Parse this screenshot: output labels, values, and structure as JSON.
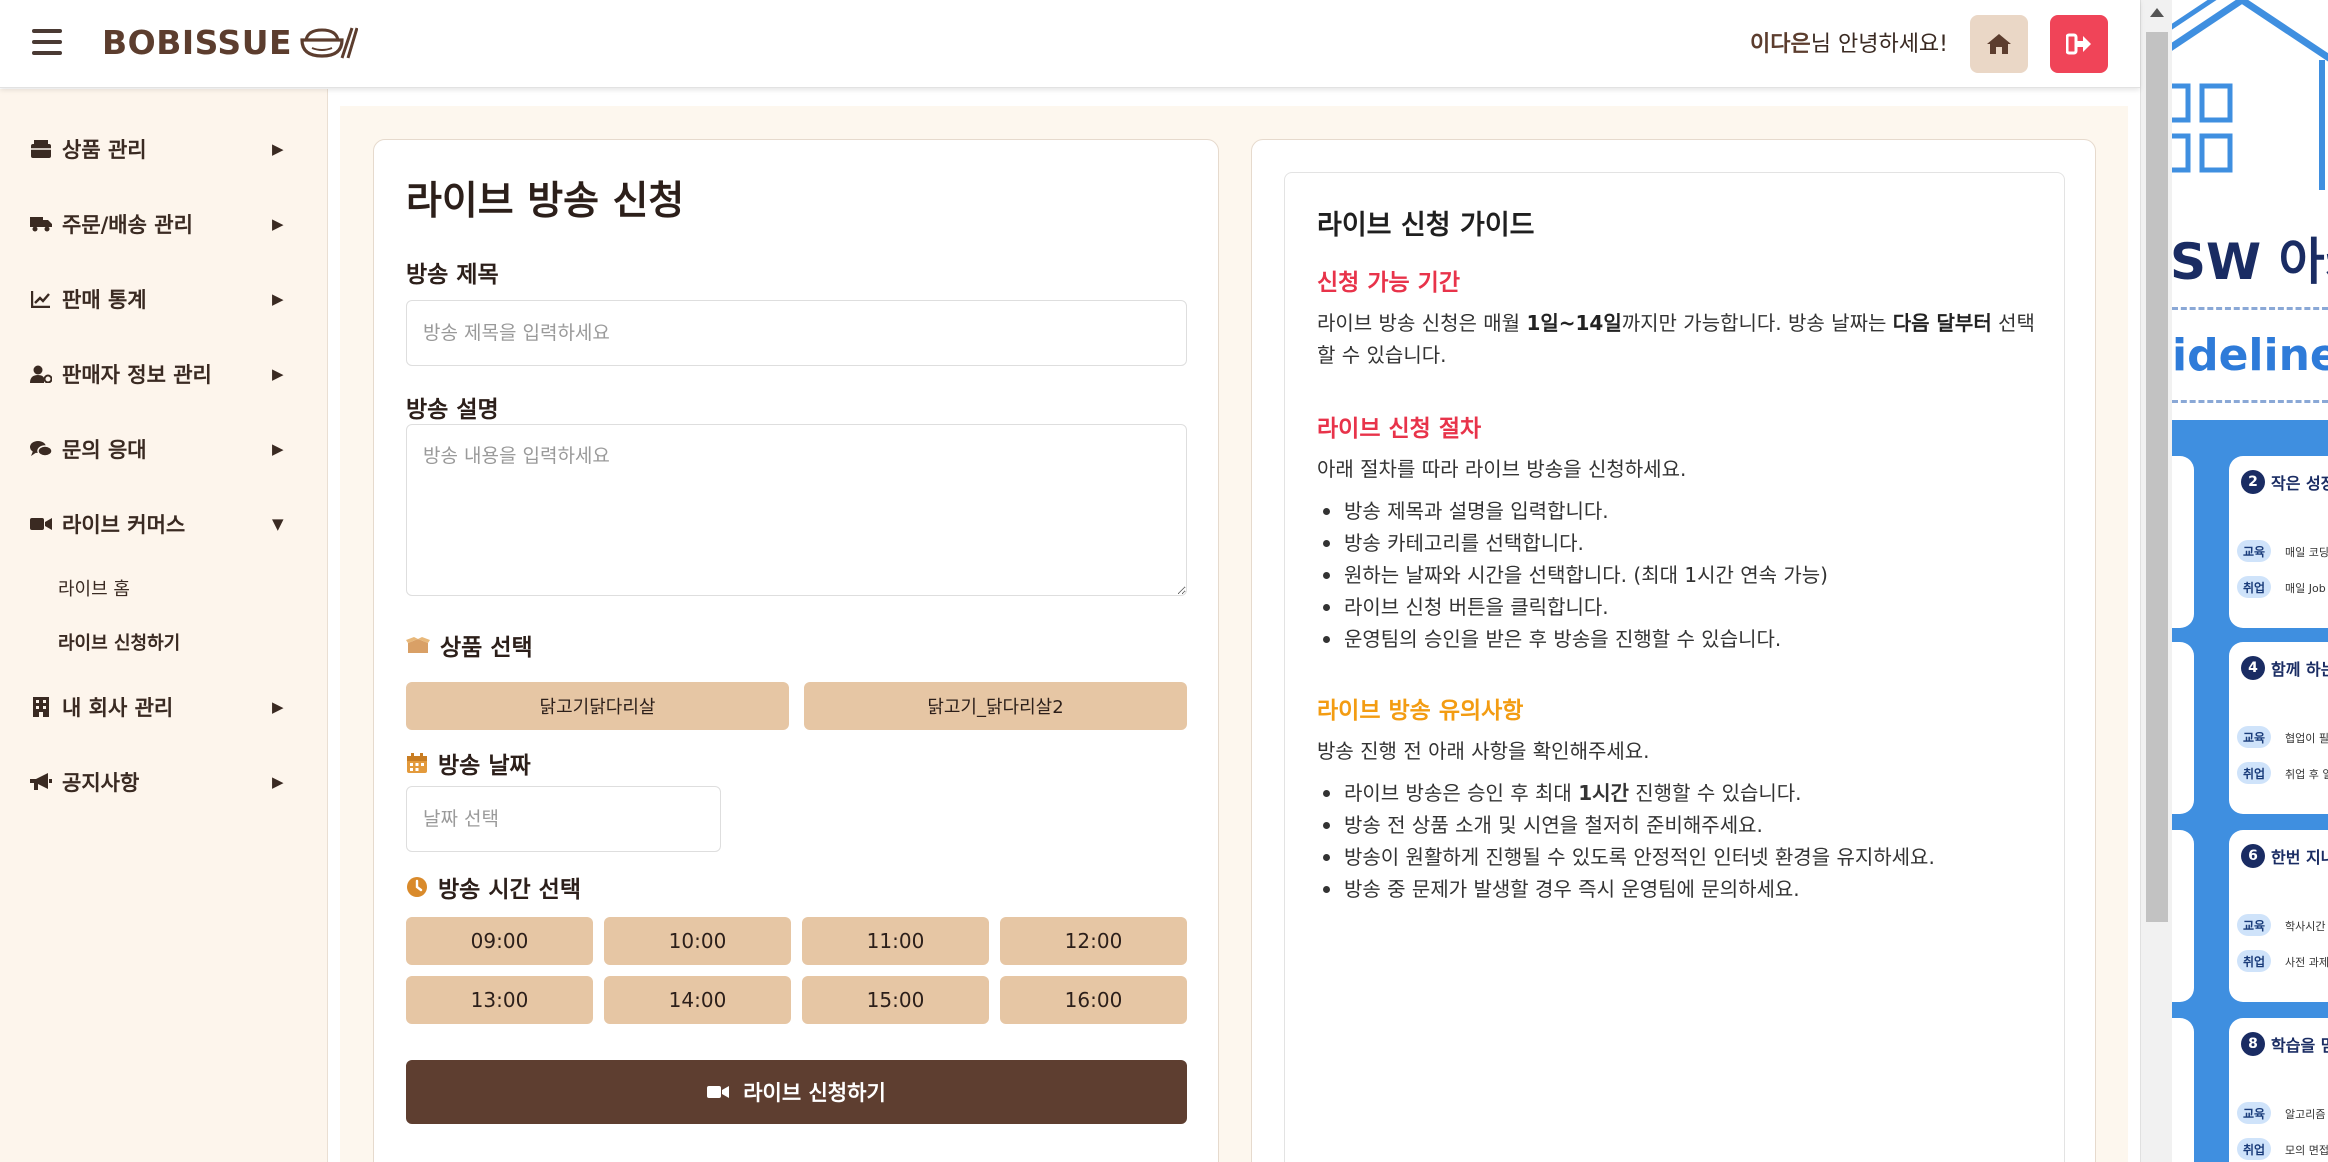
{
  "header": {
    "logo_text": "BOBISSUE",
    "user_name": "이다은",
    "greeting_suffix": "님 안녕하세요!"
  },
  "sidebar": {
    "items": [
      {
        "label": "상품 관리",
        "arrow": "▶",
        "icon": "box-icon"
      },
      {
        "label": "주문/배송 관리",
        "arrow": "▶",
        "icon": "truck-icon"
      },
      {
        "label": "판매 통계",
        "arrow": "▶",
        "icon": "chart-line-icon"
      },
      {
        "label": "판매자 정보 관리",
        "arrow": "▶",
        "icon": "user-gear-icon"
      },
      {
        "label": "문의 응대",
        "arrow": "▶",
        "icon": "comments-icon"
      },
      {
        "label": "라이브 커머스",
        "arrow": "▼",
        "icon": "video-icon"
      },
      {
        "label": "내 회사 관리",
        "arrow": "▶",
        "icon": "building-icon"
      },
      {
        "label": "공지사항",
        "arrow": "▶",
        "icon": "bullhorn-icon"
      }
    ],
    "live_sub": [
      {
        "label": "라이브 홈"
      },
      {
        "label": "라이브 신청하기"
      }
    ]
  },
  "form": {
    "title": "라이브 방송 신청",
    "title_label": "방송 제목",
    "title_placeholder": "방송 제목을 입력하세요",
    "desc_label": "방송 설명",
    "desc_placeholder": "방송 내용을 입력하세요",
    "product_label": "상품 선택",
    "products": [
      "닭고기닭다리살",
      "닭고기_닭다리살2"
    ],
    "date_label": "방송 날짜",
    "date_placeholder": "날짜 선택",
    "time_label": "방송 시간 선택",
    "times": [
      "09:00",
      "10:00",
      "11:00",
      "12:00",
      "13:00",
      "14:00",
      "15:00",
      "16:00"
    ],
    "submit_label": "라이브 신청하기"
  },
  "guide": {
    "title": "라이브 신청 가이드",
    "s1_head": "신청 가능 기간",
    "s1_t1": "라이브 방송 신청은 매월 ",
    "s1_b1": "1일~14일",
    "s1_t2": "까지만 가능합니다. 방송 날짜는 ",
    "s1_b2": "다음 달부터",
    "s1_t3": " 선택할 수 있습니다.",
    "s2_head": "라이브 신청 절차",
    "s2_intro": "아래 절차를 따라 라이브 방송을 신청하세요.",
    "s2_items": [
      "방송 제목과 설명을 입력합니다.",
      "방송 카테고리를 선택합니다.",
      "원하는 날짜와 시간을 선택합니다. (최대 1시간 연속 가능)",
      "라이브 신청 버튼을 클릭합니다.",
      "운영팀의 승인을 받은 후 방송을 진행할 수 있습니다."
    ],
    "s3_head": "라이브 방송 유의사항",
    "s3_intro": "방송 진행 전 아래 사항을 확인해주세요.",
    "s3_i1_a": "라이브 방송은 승인 후 최대 ",
    "s3_i1_b": "1시간",
    "s3_i1_c": " 진행할 수 있습니다.",
    "s3_items": [
      "방송 전 상품 소개 및 시연을 철저히 준비해주세요.",
      "방송이 원활하게 진행될 수 있도록 안정적인 인터넷 환경을 유지하세요.",
      "방송 중 문제가 발생할 경우 즉시 운영팀에 문의하세요."
    ]
  },
  "poster": {
    "title": "SW 아카",
    "subtitle": "idelines",
    "cards": [
      {
        "num": "2",
        "head": "작은 성장이",
        "tag1": "교육",
        "t1": "매일 코딩",
        "tag2": "취업",
        "t2": "매일 Job"
      },
      {
        "num": "4",
        "head": "함께 하는 등",
        "tag1": "교육",
        "t1": "협업이 필",
        "tag2": "취업",
        "t2": "취업 후 일"
      },
      {
        "num": "6",
        "head": "한번 지나간",
        "tag1": "교육",
        "t1": "학사시간",
        "tag2": "취업",
        "t2": "사전 과제"
      },
      {
        "num": "8",
        "head": "학습을 멈추",
        "tag1": "교육",
        "t1": "알고리즘",
        "tag2": "취업",
        "t2": "모의 면접"
      }
    ]
  },
  "colors": {
    "brand": "#5c3d2e",
    "accent_red": "#e8334a",
    "accent_orange": "#f39c12",
    "button_tan": "#e6c6a4",
    "sidebar_bg": "#fdf5ec"
  }
}
